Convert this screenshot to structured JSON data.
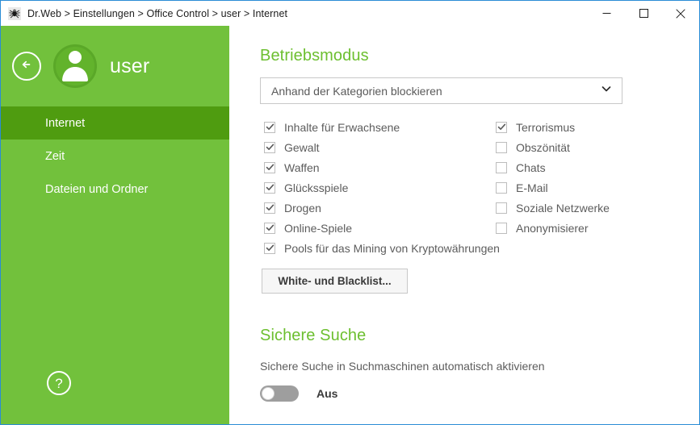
{
  "window": {
    "title": "Dr.Web > Einstellungen > Office Control > user > Internet",
    "app_icon": "spider-icon",
    "accent_border_color": "#2a8cd6",
    "controls": {
      "minimize": "minimize-icon",
      "maximize": "maximize-icon",
      "close": "close-icon"
    }
  },
  "sidebar": {
    "background_color": "#72c13c",
    "selected_color": "#4f9c10",
    "back_icon": "arrow-left-icon",
    "avatar_icon": "user-avatar-icon",
    "user_name": "user",
    "items": [
      {
        "label": "Internet",
        "selected": true
      },
      {
        "label": "Zeit",
        "selected": false
      },
      {
        "label": "Dateien und Ordner",
        "selected": false
      }
    ],
    "help_icon": "question-mark-icon",
    "help_label": "?"
  },
  "content": {
    "mode": {
      "title": "Betriebsmodus",
      "title_color": "#6cbf2f",
      "select_value": "Anhand der Kategorien blockieren",
      "select_icon": "chevron-down-icon"
    },
    "categories_left": [
      {
        "label": "Inhalte für Erwachsene",
        "checked": true
      },
      {
        "label": "Gewalt",
        "checked": true
      },
      {
        "label": "Waffen",
        "checked": true
      },
      {
        "label": "Glücksspiele",
        "checked": true
      },
      {
        "label": "Drogen",
        "checked": true
      },
      {
        "label": "Online-Spiele",
        "checked": true
      },
      {
        "label": "Pools für das Mining von Kryptowährungen",
        "checked": true
      }
    ],
    "categories_right": [
      {
        "label": "Terrorismus",
        "checked": true
      },
      {
        "label": "Obszönität",
        "checked": false
      },
      {
        "label": "Chats",
        "checked": false
      },
      {
        "label": "E-Mail",
        "checked": false
      },
      {
        "label": "Soziale Netzwerke",
        "checked": false
      },
      {
        "label": "Anonymisierer",
        "checked": false
      }
    ],
    "blacklist_button": "White- und Blacklist...",
    "safe_search": {
      "title": "Sichere Suche",
      "description": "Sichere Suche in Suchmaschinen automatisch aktivieren",
      "toggle_state_label": "Aus",
      "toggle_on": false
    }
  }
}
